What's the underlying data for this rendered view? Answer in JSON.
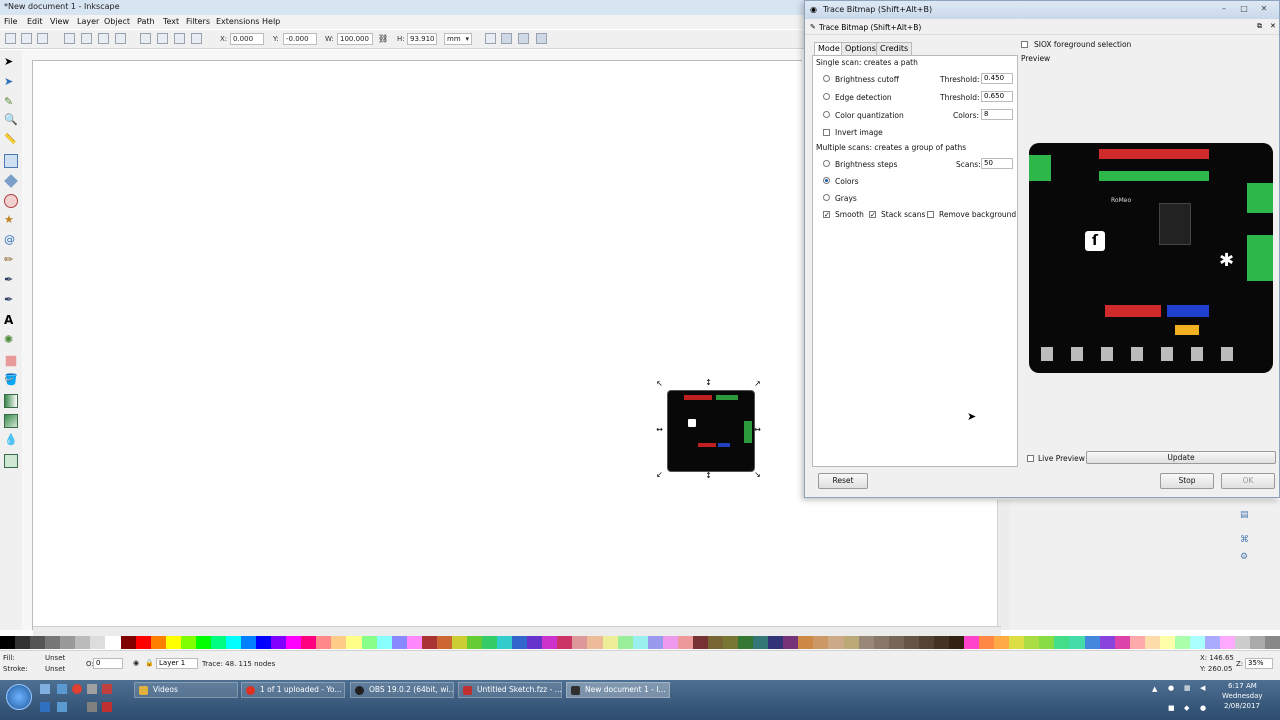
{
  "window": {
    "title": "*New document 1 - Inkscape"
  },
  "menu": [
    "File",
    "Edit",
    "View",
    "Layer",
    "Object",
    "Path",
    "Text",
    "Filters",
    "Extensions",
    "Help"
  ],
  "toolbar": {
    "x_label": "X:",
    "x_value": "0.000",
    "y_label": "Y:",
    "y_value": "-0.000",
    "w_label": "W:",
    "w_value": "100.000",
    "h_label": "H:",
    "h_value": "93.910",
    "unit": "mm"
  },
  "dialog": {
    "title": "Trace Bitmap (Shift+Alt+B)",
    "subtitle": "Trace Bitmap (Shift+Alt+B)",
    "tabs": [
      "Mode",
      "Options",
      "Credits"
    ],
    "single_scan_header": "Single scan: creates a path",
    "brightness_cutoff": "Brightness cutoff",
    "threshold_label": "Threshold:",
    "brightness_threshold": "0.450",
    "edge_detection": "Edge detection",
    "edge_threshold": "0.650",
    "color_quantization": "Color quantization",
    "colors_label": "Colors:",
    "colors_value": "8",
    "invert_image": "Invert image",
    "multi_scan_header": "Multiple scans: creates a group of paths",
    "brightness_steps": "Brightness steps",
    "scans_label": "Scans:",
    "scans_value": "50",
    "colors_option": "Colors",
    "grays_option": "Grays",
    "smooth": "Smooth",
    "stack_scans": "Stack scans",
    "remove_background": "Remove background",
    "siox": "SIOX foreground selection",
    "preview_label": "Preview",
    "live_preview": "Live Preview",
    "update_button": "Update",
    "reset_button": "Reset",
    "stop_button": "Stop",
    "ok_button": "OK",
    "board_label": "RoMeo"
  },
  "status": {
    "fill_label": "Fill:",
    "fill_value": "Unset",
    "stroke_label": "Stroke:",
    "stroke_value": "Unset",
    "opacity_label": "O:",
    "opacity_value": "0",
    "layer": "Layer 1",
    "message": "Trace: 48.  115 nodes",
    "x_coord": "X: 146.65",
    "y_coord": "Y: 260.05",
    "zoom_label": "Z:",
    "zoom_value": "35%"
  },
  "taskbar": {
    "items": [
      "Videos",
      "1 of 1 uploaded - Yo...",
      "OBS 19.0.2 (64bit, wi...",
      "Untitled Sketch.fzz - ...",
      "New document 1 - I..."
    ],
    "time": "6:17 AM",
    "day": "Wednesday",
    "date": "2/08/2017"
  },
  "colors": {
    "accent": "#1c5fb0",
    "board": "#080808"
  }
}
